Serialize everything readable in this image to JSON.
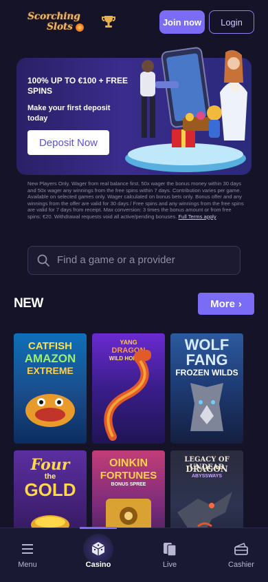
{
  "header": {
    "logo_line1": "Scorching",
    "logo_line2": "Slots",
    "join_label": "Join now",
    "login_label": "Login"
  },
  "promo": {
    "title": "100% UP TO €100 + FREE SPINS",
    "subtitle": "Make your first deposit today",
    "deposit_label": "Deposit Now"
  },
  "terms": {
    "text": "New Players Only. Wager from real balance first. 50x wager the bonus money within 30 days and 50x wager any winnings from the free spins within 7 days. Contribution varies per game. Available on selected games only. Wager calculated on bonus bets only. Bonus offer and any winnings from the offer are valid for 30 days / Free spins and any winnings from the free spins are valid for 7 days from receipt. Max conversion: 3 times the bonus amount or from free spins: €20. Withdrawal requests void all active/pending bonuses.",
    "link_label": "Full Terms apply"
  },
  "search": {
    "placeholder": "Find a game or a provider"
  },
  "new_section": {
    "title": "NEW",
    "more_label": "More",
    "more_chevron": "›",
    "games": [
      {
        "l1": "CATFISH",
        "l2": "AMAZON",
        "l3": "EXTREME"
      },
      {
        "l1": "YANG",
        "l2": "DRAGON",
        "l3": "WILD HORSES"
      },
      {
        "l1": "WOLF",
        "l2": "FANG",
        "l3": "FROZEN WILDS"
      },
      {
        "l1": "Four",
        "l2": "the",
        "l3": "GOLD"
      },
      {
        "l1": "OINKIN",
        "l2": "FORTUNES",
        "l3": "BONUS SPREE"
      },
      {
        "l1": "LEGACY OF UNDEAD",
        "l2": "DRAGON",
        "l3": "ABYSSWAYS"
      }
    ]
  },
  "nav": {
    "items": [
      {
        "label": "Menu",
        "icon": "hamburger-icon"
      },
      {
        "label": "Casino",
        "icon": "dice-icon"
      },
      {
        "label": "Live",
        "icon": "playing-cards-icon"
      },
      {
        "label": "Cashier",
        "icon": "wallet-icon"
      }
    ],
    "active": "Casino"
  },
  "colors": {
    "background": "#141327",
    "accent": "#7b6cf6",
    "nav_bg": "#1a1933"
  }
}
